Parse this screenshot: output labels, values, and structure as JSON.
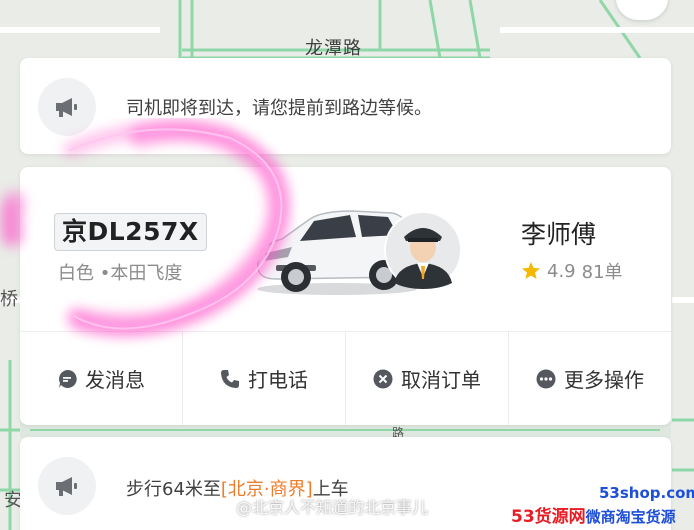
{
  "map": {
    "road_label": "龙潭路",
    "left_edge_top": "桥",
    "left_edge_bottom": "安",
    "partial_road": "路",
    "road_color": "#7ccf98"
  },
  "notice": {
    "icon": "megaphone-icon",
    "text": "司机即将到达，请您提前到路边等候。"
  },
  "driver": {
    "plate": "京DL257X",
    "car_desc": "白色 •本田飞度",
    "name": "李师傅",
    "rating": "4.9",
    "orders": "81单",
    "star_color": "#f5b800"
  },
  "actions": [
    {
      "label": "发消息",
      "icon": "message-icon"
    },
    {
      "label": "打电话",
      "icon": "phone-icon"
    },
    {
      "label": "取消订单",
      "icon": "cancel-icon"
    },
    {
      "label": "更多操作",
      "icon": "more-icon"
    }
  ],
  "walk": {
    "prefix": "步行64米至",
    "destination": "[北京·商界]",
    "suffix": "上车",
    "accent": "#f07c2a"
  },
  "watermark": {
    "weibo": "@北京人不知道的北京事儿",
    "site": "53shop.com",
    "brand_red": "53货源网",
    "brand_blue": "微商淘宝货源"
  },
  "highlight_color": "#ff4fc8"
}
